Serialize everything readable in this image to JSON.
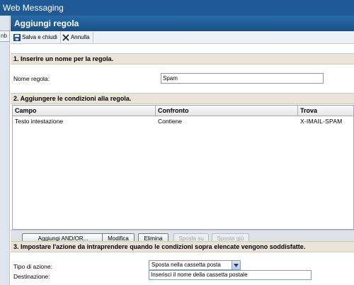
{
  "app": {
    "title": "Web Messaging",
    "left_tab": "nb"
  },
  "dialog": {
    "title": "Aggiungi regola"
  },
  "toolbar": {
    "save_label": "Salva e chiudi",
    "cancel_label": "Annulla"
  },
  "section1": {
    "title": "1. Inserire un nome per la regola.",
    "name_label": "Nome regola:",
    "name_value": "Spam"
  },
  "section2": {
    "title": "2. Aggiungere le condizioni alla regola.",
    "columns": [
      "Campo",
      "Confronto",
      "Trova"
    ],
    "rows": [
      {
        "campo": "Testo intestazione",
        "confronto": "Contiene",
        "trova": "X-IMAIL-SPAM"
      }
    ],
    "buttons": {
      "add": "Aggiungi AND/OR...",
      "edit": "Modifica",
      "delete": "Elimina",
      "move_up": "Sposta su",
      "move_down": "Sposta giù"
    }
  },
  "section3": {
    "title": "3. Impostare l'azione da intraprendere quando le condizioni sopra elencate vengono soddisfatte.",
    "action_label": "Tipo di azione:",
    "action_value": "Sposta nella cassetta posta",
    "dest_label": "Destinazione:",
    "dest_value": "Inserisci il nome della cassetta postale"
  },
  "colors": {
    "title_bar": "#1f5a96",
    "section_bar": "#e8e4d8",
    "header_bar": "#185086"
  }
}
